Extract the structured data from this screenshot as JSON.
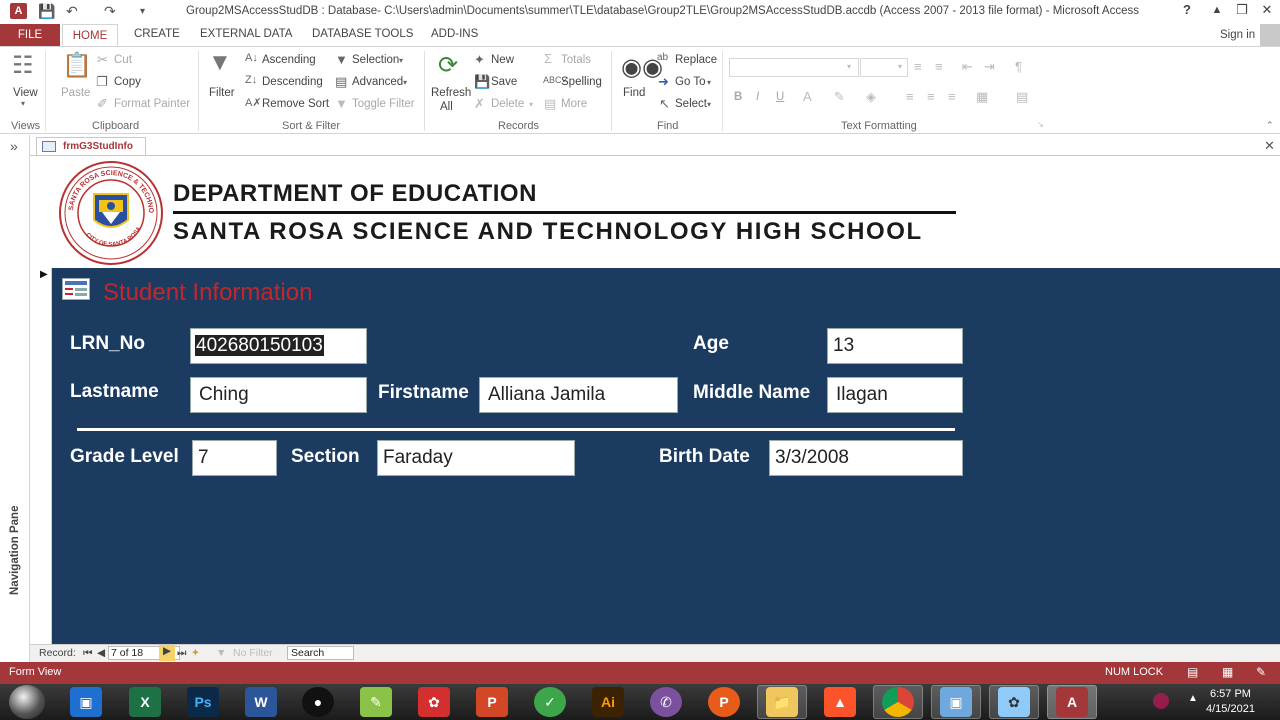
{
  "window": {
    "title": "Group2MSAccessStudDB : Database- C:\\Users\\admin\\Documents\\summer\\TLE\\database\\Group2TLE\\Group2MSAccessStudDB.accdb (Access 2007 - 2013 file format) - Microsoft Access",
    "help": "?",
    "minimize": "–",
    "restore": "❒",
    "close": "✕",
    "app_icon_label": "A"
  },
  "ribbon_tabs": {
    "file": "FILE",
    "home": "HOME",
    "create": "CREATE",
    "external_data": "EXTERNAL DATA",
    "database_tools": "DATABASE TOOLS",
    "add_ins": "ADD-INS",
    "sign_in": "Sign in"
  },
  "ribbon": {
    "views": {
      "view": "View",
      "group": "Views"
    },
    "clipboard": {
      "paste": "Paste",
      "cut": "Cut",
      "copy": "Copy",
      "format_painter": "Format Painter",
      "group": "Clipboard"
    },
    "sort_filter": {
      "filter": "Filter",
      "ascending": "Ascending",
      "descending": "Descending",
      "remove_sort": "Remove Sort",
      "selection": "Selection",
      "advanced": "Advanced",
      "toggle_filter": "Toggle Filter",
      "group": "Sort & Filter"
    },
    "records": {
      "refresh": "Refresh",
      "refresh_all": "All",
      "new": "New",
      "save": "Save",
      "delete": "Delete",
      "totals": "Totals",
      "spelling": "Spelling",
      "more": "More",
      "group": "Records"
    },
    "find": {
      "find": "Find",
      "replace": "Replace",
      "goto": "Go To",
      "select": "Select",
      "group": "Find"
    },
    "text_formatting": {
      "bold": "B",
      "italic": "I",
      "underline": "U",
      "group": "Text Formatting"
    }
  },
  "nav_pane": {
    "label": "Navigation Pane",
    "toggle": "»"
  },
  "doc_tab": {
    "label": "frmG3StudInfo",
    "close": "✕"
  },
  "header": {
    "line1": "DEPARTMENT OF EDUCATION",
    "line2": "SANTA ROSA SCIENCE AND TECHNOLOGY HIGH SCHOOL",
    "seal_text": "SANTA ROSA SCIENCE & TECHNOLOGY HIGH SCHOOL",
    "seal_bottom": "CITY OF SANTA ROSA"
  },
  "form": {
    "section_title": "Student Information",
    "labels": {
      "lrn": "LRN_No",
      "age": "Age",
      "lastname": "Lastname",
      "firstname": "Firstname",
      "middlename": "Middle Name",
      "grade_level": "Grade Level",
      "section": "Section",
      "birth_date": "Birth Date"
    },
    "values": {
      "lrn": "402680150103",
      "age": "13",
      "lastname": "Ching",
      "firstname": "Alliana Jamila",
      "middlename": "Ilagan",
      "grade_level": "7",
      "section": "Faraday",
      "birth_date": "3/3/2008"
    }
  },
  "record_nav": {
    "label": "Record:",
    "position": "7 of 18",
    "no_filter": "No Filter",
    "search": "Search"
  },
  "status": {
    "view": "Form View",
    "num_lock": "NUM LOCK"
  },
  "taskbar": {
    "apps": [
      "chrome-remote",
      "explorer-frame",
      "excel",
      "photoshop",
      "word",
      "obs",
      "notepad",
      "acrobat",
      "powerpoint",
      "camtasia",
      "illustrator",
      "viber",
      "potplayer",
      "file-explorer",
      "brave",
      "chrome",
      "virtualbox",
      "paint",
      "access"
    ],
    "labels": {
      "excel": "X",
      "photoshop": "Ps",
      "word": "W",
      "illustrator": "Ai",
      "powerpoint": "P",
      "access": "A",
      "potplayer": "P"
    },
    "time": "6:57 PM",
    "date": "4/15/2021"
  },
  "colors": {
    "access_red": "#a4373a",
    "form_background": "#1b3b61",
    "section_title": "#c4272b"
  }
}
